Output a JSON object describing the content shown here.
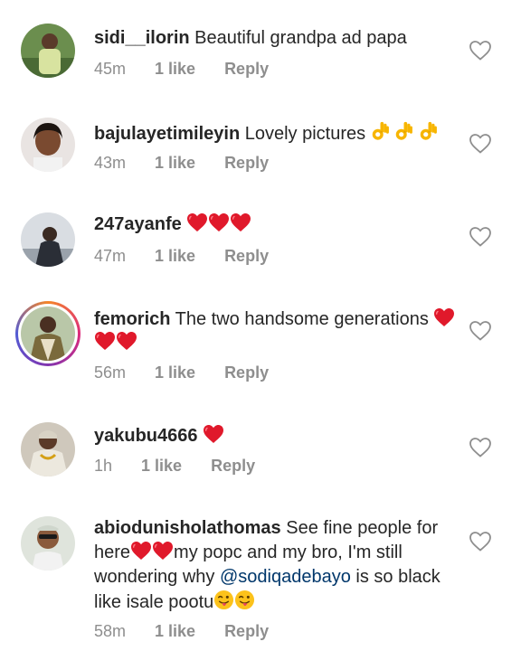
{
  "comments": [
    {
      "username": "sidi__ilorin",
      "text": " Beautiful grandpa ad papa",
      "time": "45m",
      "likes": "1 like",
      "reply": "Reply"
    },
    {
      "username": "bajulayetimileyin",
      "text": " Lovely pictures ",
      "emojis": [
        "ok-hand-emoji",
        "ok-hand-emoji",
        "ok-hand-emoji"
      ],
      "time": "43m",
      "likes": "1 like",
      "reply": "Reply"
    },
    {
      "username": "247ayanfe",
      "text": " ",
      "emojis": [
        "red-heart-emoji",
        "red-heart-emoji",
        "red-heart-emoji"
      ],
      "time": "47m",
      "likes": "1 like",
      "reply": "Reply"
    },
    {
      "username": "femorich",
      "text": " The two handsome generations ",
      "emojis": [
        "red-heart-emoji",
        "red-heart-emoji",
        "red-heart-emoji"
      ],
      "has_story_ring": true,
      "time": "56m",
      "likes": "1 like",
      "reply": "Reply"
    },
    {
      "username": "yakubu4666",
      "text": " ",
      "emojis": [
        "red-heart-emoji"
      ],
      "time": "1h",
      "likes": "1 like",
      "reply": "Reply"
    },
    {
      "username": "abiodunisholathomas",
      "text_part1": " See fine people for here",
      "text_part2": "my popc and my bro, I'm still wondering why ",
      "mention": "@sodiqadebayo",
      "text_part3": " is so black like isale pootu",
      "emojis_a": [
        "red-heart-emoji",
        "red-heart-emoji"
      ],
      "emojis_b": [
        "tongue-wink-emoji",
        "tongue-wink-emoji"
      ],
      "time": "58m",
      "likes": "1 like",
      "reply": "Reply"
    }
  ],
  "icons": {
    "like": "heart-outline-icon"
  },
  "colors": {
    "text": "#262626",
    "meta": "#8e8e8e",
    "mention": "#00376b",
    "heart_emoji": "#e0192b",
    "ok_hand": "#f7b500"
  }
}
